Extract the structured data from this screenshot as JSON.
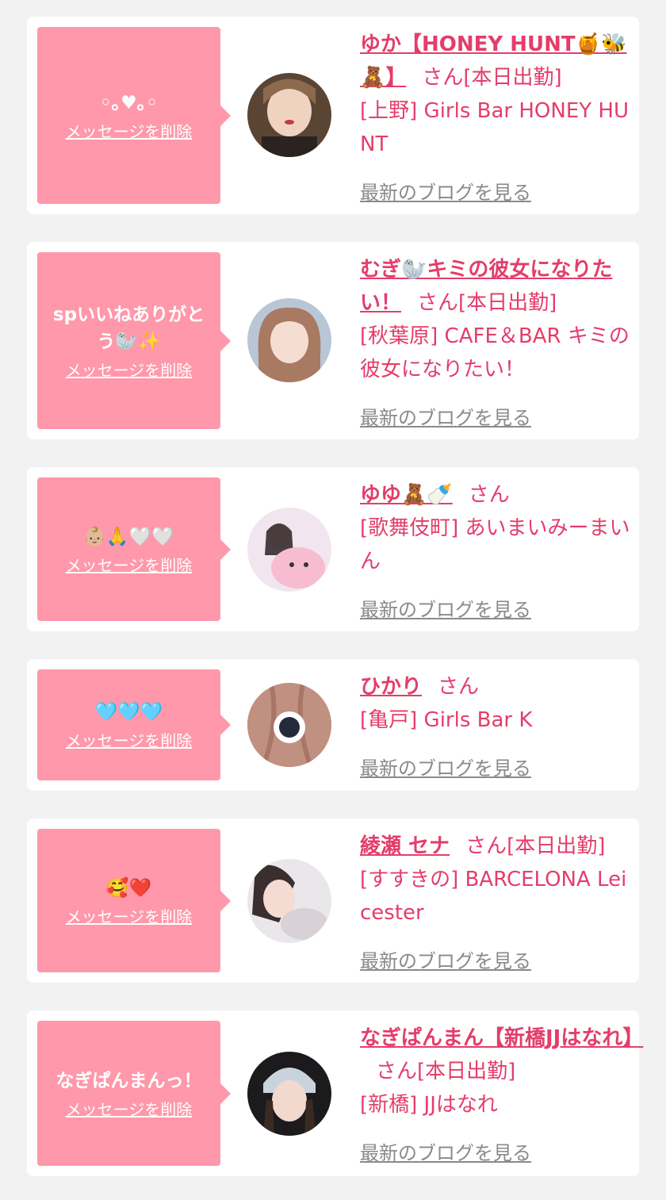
{
  "blog_link_label": "最新のブログを見る",
  "delete_label": "メッセージを削除",
  "san_label": "さん",
  "cards": [
    {
      "message": "◦｡♥｡◦",
      "name": "ゆか【HONEY HUNT🍯🐝🧸】",
      "status": "[本日出勤]",
      "shop": "[上野] Girls Bar HONEY HUNT"
    },
    {
      "message": "spいいねありがとう🦭✨",
      "name": "むぎ🦭キミの彼女になりたい！",
      "status": "[本日出勤]",
      "shop": "[秋葉原] CAFE＆BAR キミの彼女になりたい！"
    },
    {
      "message": "👶🏼🙏🤍🤍",
      "name": "ゆゆ🧸🍼",
      "status": "",
      "shop": "[歌舞伎町] あいまいみーまいん"
    },
    {
      "message": "🩵🩵🩵",
      "name": "ひかり",
      "status": "",
      "shop": "[亀戸] Girls Bar K"
    },
    {
      "message": "🥰❤️",
      "name": "綾瀬 セナ",
      "status": "[本日出勤]",
      "shop": "[すすきの] BARCELONA Leicester"
    },
    {
      "message": "なぎぱんまんっ！",
      "name": "なぎぱんまん【新橋JJはなれ】",
      "status": "[本日出勤]",
      "shop": "[新橋] JJはなれ"
    }
  ],
  "colors": {
    "background": "#f2f2f2",
    "card": "#ffffff",
    "bubble": "#ff98aa",
    "accent": "#e43d6b",
    "link_gray": "#8a8a8a"
  }
}
